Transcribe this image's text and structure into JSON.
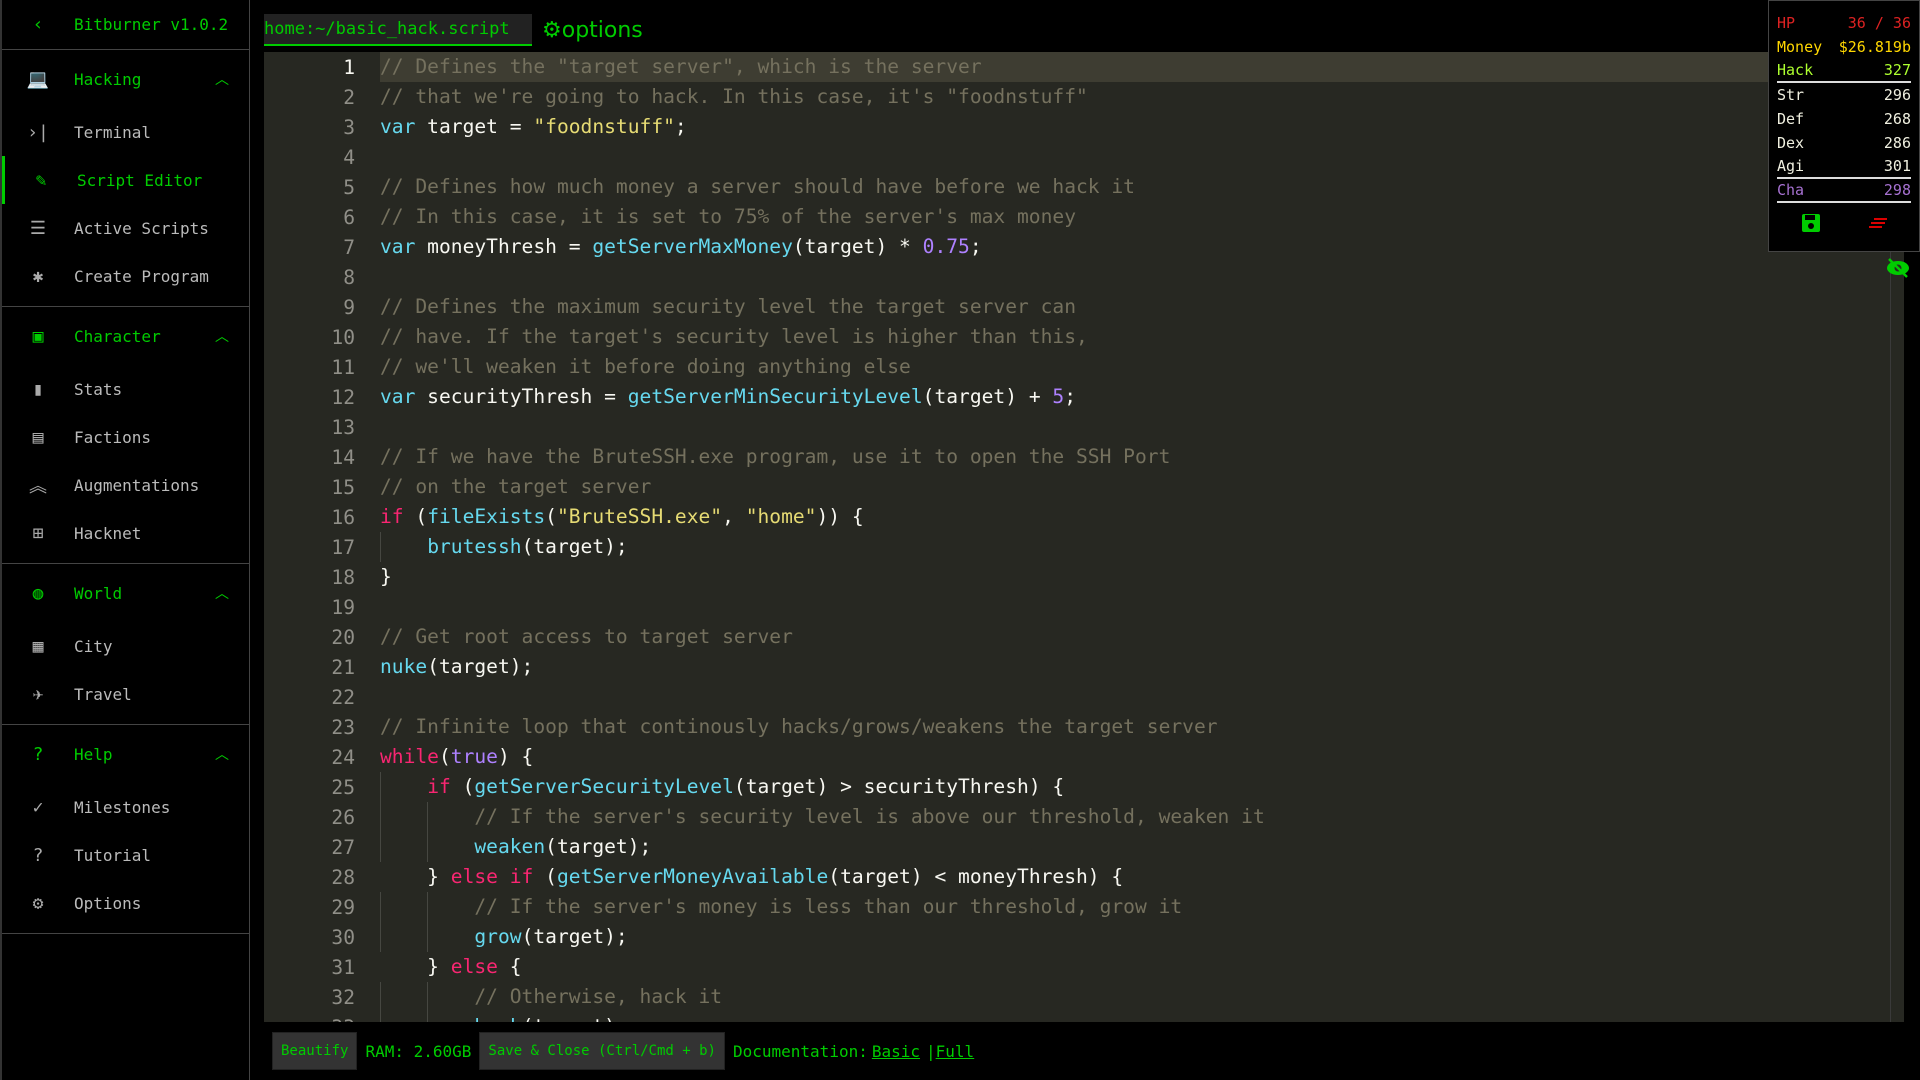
{
  "app": {
    "title": "Bitburner v1.0.2"
  },
  "sidebar": {
    "sections": [
      {
        "label": "Hacking",
        "icon": "laptop-icon",
        "items": [
          {
            "label": "Terminal",
            "icon": "terminal-icon"
          },
          {
            "label": "Script Editor",
            "icon": "pencil-icon",
            "active": true
          },
          {
            "label": "Active Scripts",
            "icon": "list-icon"
          },
          {
            "label": "Create Program",
            "icon": "bug-icon"
          }
        ]
      },
      {
        "label": "Character",
        "icon": "account-box-icon",
        "items": [
          {
            "label": "Stats",
            "icon": "bar-chart-icon"
          },
          {
            "label": "Factions",
            "icon": "contacts-icon"
          },
          {
            "label": "Augmentations",
            "icon": "double-arrow-up-icon"
          },
          {
            "label": "Hacknet",
            "icon": "account-tree-icon"
          }
        ]
      },
      {
        "label": "World",
        "icon": "globe-icon",
        "items": [
          {
            "label": "City",
            "icon": "city-icon"
          },
          {
            "label": "Travel",
            "icon": "airplane-icon"
          }
        ]
      },
      {
        "label": "Help",
        "icon": "live-help-icon",
        "items": [
          {
            "label": "Milestones",
            "icon": "check-icon"
          },
          {
            "label": "Tutorial",
            "icon": "help-icon"
          },
          {
            "label": "Options",
            "icon": "gear-icon"
          }
        ]
      }
    ]
  },
  "editor": {
    "tab": "home:~/basic_hack.script",
    "options_label": "options",
    "lines": [
      [
        [
          "c",
          "// Defines the \"target server\", which is the server"
        ]
      ],
      [
        [
          "c",
          "// that we're going to hack. In this case, it's \"foodnstuff\""
        ]
      ],
      [
        [
          "f",
          "var"
        ],
        [
          "p",
          " target = "
        ],
        [
          "s",
          "\"foodnstuff\""
        ],
        [
          "p",
          ";"
        ]
      ],
      [],
      [
        [
          "c",
          "// Defines how much money a server should have before we hack it"
        ]
      ],
      [
        [
          "c",
          "// In this case, it is set to 75% of the server's max money"
        ]
      ],
      [
        [
          "f",
          "var"
        ],
        [
          "p",
          " moneyThresh = "
        ],
        [
          "f",
          "getServerMaxMoney"
        ],
        [
          "p",
          "(target) * "
        ],
        [
          "n",
          "0.75"
        ],
        [
          "p",
          ";"
        ]
      ],
      [],
      [
        [
          "c",
          "// Defines the maximum security level the target server can"
        ]
      ],
      [
        [
          "c",
          "// have. If the target's security level is higher than this,"
        ]
      ],
      [
        [
          "c",
          "// we'll weaken it before doing anything else"
        ]
      ],
      [
        [
          "f",
          "var"
        ],
        [
          "p",
          " securityThresh = "
        ],
        [
          "f",
          "getServerMinSecurityLevel"
        ],
        [
          "p",
          "(target) + "
        ],
        [
          "n",
          "5"
        ],
        [
          "p",
          ";"
        ]
      ],
      [],
      [
        [
          "c",
          "// If we have the BruteSSH.exe program, use it to open the SSH Port"
        ]
      ],
      [
        [
          "c",
          "// on the target server"
        ]
      ],
      [
        [
          "k",
          "if"
        ],
        [
          "p",
          " ("
        ],
        [
          "f",
          "fileExists"
        ],
        [
          "p",
          "("
        ],
        [
          "s",
          "\"BruteSSH.exe\""
        ],
        [
          "p",
          ", "
        ],
        [
          "s",
          "\"home\""
        ],
        [
          "p",
          ")) {"
        ]
      ],
      [
        [
          "p",
          "    "
        ],
        [
          "f",
          "brutessh"
        ],
        [
          "p",
          "(target);"
        ]
      ],
      [
        [
          "p",
          "}"
        ]
      ],
      [],
      [
        [
          "c",
          "// Get root access to target server"
        ]
      ],
      [
        [
          "f",
          "nuke"
        ],
        [
          "p",
          "(target);"
        ]
      ],
      [],
      [
        [
          "c",
          "// Infinite loop that continously hacks/grows/weakens the target server"
        ]
      ],
      [
        [
          "k",
          "while"
        ],
        [
          "p",
          "("
        ],
        [
          "n",
          "true"
        ],
        [
          "p",
          ") {"
        ]
      ],
      [
        [
          "p",
          "    "
        ],
        [
          "k",
          "if"
        ],
        [
          "p",
          " ("
        ],
        [
          "f",
          "getServerSecurityLevel"
        ],
        [
          "p",
          "(target) > securityThresh) {"
        ]
      ],
      [
        [
          "p",
          "        "
        ],
        [
          "c",
          "// If the server's security level is above our threshold, weaken it"
        ]
      ],
      [
        [
          "p",
          "        "
        ],
        [
          "f",
          "weaken"
        ],
        [
          "p",
          "(target);"
        ]
      ],
      [
        [
          "p",
          "    } "
        ],
        [
          "k",
          "else if"
        ],
        [
          "p",
          " ("
        ],
        [
          "f",
          "getServerMoneyAvailable"
        ],
        [
          "p",
          "(target) < moneyThresh) {"
        ]
      ],
      [
        [
          "p",
          "        "
        ],
        [
          "c",
          "// If the server's money is less than our threshold, grow it"
        ]
      ],
      [
        [
          "p",
          "        "
        ],
        [
          "f",
          "grow"
        ],
        [
          "p",
          "(target);"
        ]
      ],
      [
        [
          "p",
          "    } "
        ],
        [
          "k",
          "else"
        ],
        [
          "p",
          " {"
        ]
      ],
      [
        [
          "p",
          "        "
        ],
        [
          "c",
          "// Otherwise, hack it"
        ]
      ],
      [
        [
          "p",
          "        "
        ],
        [
          "f",
          "hack"
        ],
        [
          "p",
          "(target);"
        ]
      ]
    ]
  },
  "bottom": {
    "beautify": "Beautify",
    "ram": "RAM: 2.60GB",
    "save": "Save & Close (Ctrl/Cmd + b)",
    "doc": "Documentation:",
    "basic": "Basic",
    "sep": "|",
    "full": "Full"
  },
  "stats": {
    "hp": {
      "label": "HP",
      "value": "36 / 36"
    },
    "money": {
      "label": "Money",
      "value": "$26.819b"
    },
    "hack": {
      "label": "Hack",
      "value": "327"
    },
    "str": {
      "label": "Str",
      "value": "296"
    },
    "def": {
      "label": "Def",
      "value": "268"
    },
    "dex": {
      "label": "Dex",
      "value": "286"
    },
    "agi": {
      "label": "Agi",
      "value": "301"
    },
    "cha": {
      "label": "Cha",
      "value": "298"
    }
  },
  "colors": {
    "accent": "#00cc00",
    "editor_bg": "#272822",
    "keyword": "#f92672",
    "function": "#66d9ef",
    "string": "#e6db74",
    "number": "#ae81ff",
    "comment": "#75715e"
  }
}
